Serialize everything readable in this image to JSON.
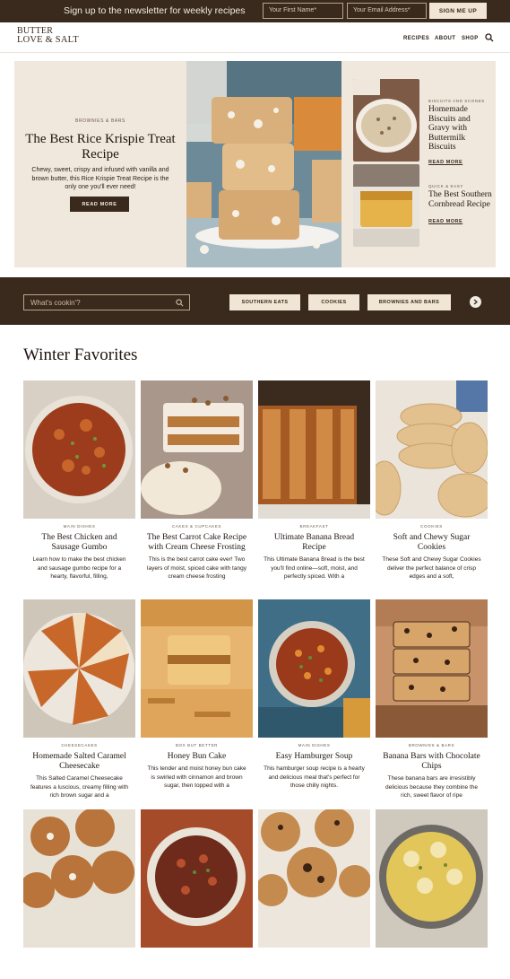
{
  "topbar": {
    "promo": "Sign up to the newsletter for weekly recipes",
    "first_name_placeholder": "Your First Name*",
    "email_placeholder": "Your Email Address*",
    "signup_label": "SIGN ME UP"
  },
  "header": {
    "logo_line1": "BUTTER",
    "logo_line2": "LOVE & SALT",
    "nav": [
      "RECIPES",
      "ABOUT",
      "SHOP"
    ]
  },
  "hero": {
    "kicker": "BROWNIES & BARS",
    "title": "The Best Rice Krispie Treat Recipe",
    "description": "Chewy, sweet, crispy and infused with vanilla and brown butter, this Rice Krispie Treat Recipe is the only one you'll ever need!",
    "button": "READ MORE",
    "side": [
      {
        "kicker": "BISCUITS AND SCONES",
        "title": "Homemade Biscuits and Gravy with Buttermilk Biscuits",
        "link": "READ MORE"
      },
      {
        "kicker": "QUICK & EASY",
        "title": "The Best Southern Cornbread Recipe",
        "link": "READ MORE"
      }
    ]
  },
  "catbar": {
    "search_placeholder": "What's cookin'?",
    "chips": [
      "SOUTHERN EATS",
      "COOKIES",
      "BROWNIES AND BARS"
    ]
  },
  "section": {
    "title": "Winter Favorites",
    "cards": [
      {
        "kicker": "MAIN DISHES",
        "title": "The Best Chicken and Sausage Gumbo",
        "desc": "Learn how to make the best chicken and sausage gumbo recipe for a hearty, flavorful, filling,"
      },
      {
        "kicker": "CAKES & CUPCAKES",
        "title": "The Best Carrot Cake Recipe with Cream Cheese Frosting",
        "desc": "This is the best carrot cake ever! Two layers of moist, spiced cake with tangy cream cheese frosting"
      },
      {
        "kicker": "BREAKFAST",
        "title": "Ultimate Banana Bread Recipe",
        "desc": "This Ultimate Banana Bread is the best you'll find online—soft, moist, and perfectly spiced. With a"
      },
      {
        "kicker": "COOKIES",
        "title": "Soft and Chewy Sugar Cookies",
        "desc": "These Soft and Chewy Sugar Cookies deliver the perfect balance of crisp edges and a soft,"
      },
      {
        "kicker": "CHEESECAKES",
        "title": "Homemade Salted Caramel Cheesecake",
        "desc": "This Salted Caramel Cheesecake features a luscious, creamy filling with rich brown sugar and a"
      },
      {
        "kicker": "BOX BUT BETTER",
        "title": "Honey Bun Cake",
        "desc": "This tender and moist honey bun cake is swirled with cinnamon and brown sugar, then topped with a"
      },
      {
        "kicker": "MAIN DISHES",
        "title": "Easy Hamburger Soup",
        "desc": "This hamburger soup recipe is a hearty and delicious meal that's perfect for those chilly nights."
      },
      {
        "kicker": "BROWNIES & BARS",
        "title": "Banana Bars with Chocolate Chips",
        "desc": "These banana bars are irresistibly delicious because they combine the rich, sweet flavor of ripe"
      },
      {
        "kicker": "",
        "title": "",
        "desc": ""
      },
      {
        "kicker": "",
        "title": "",
        "desc": ""
      },
      {
        "kicker": "",
        "title": "",
        "desc": ""
      },
      {
        "kicker": "",
        "title": "",
        "desc": ""
      }
    ]
  }
}
